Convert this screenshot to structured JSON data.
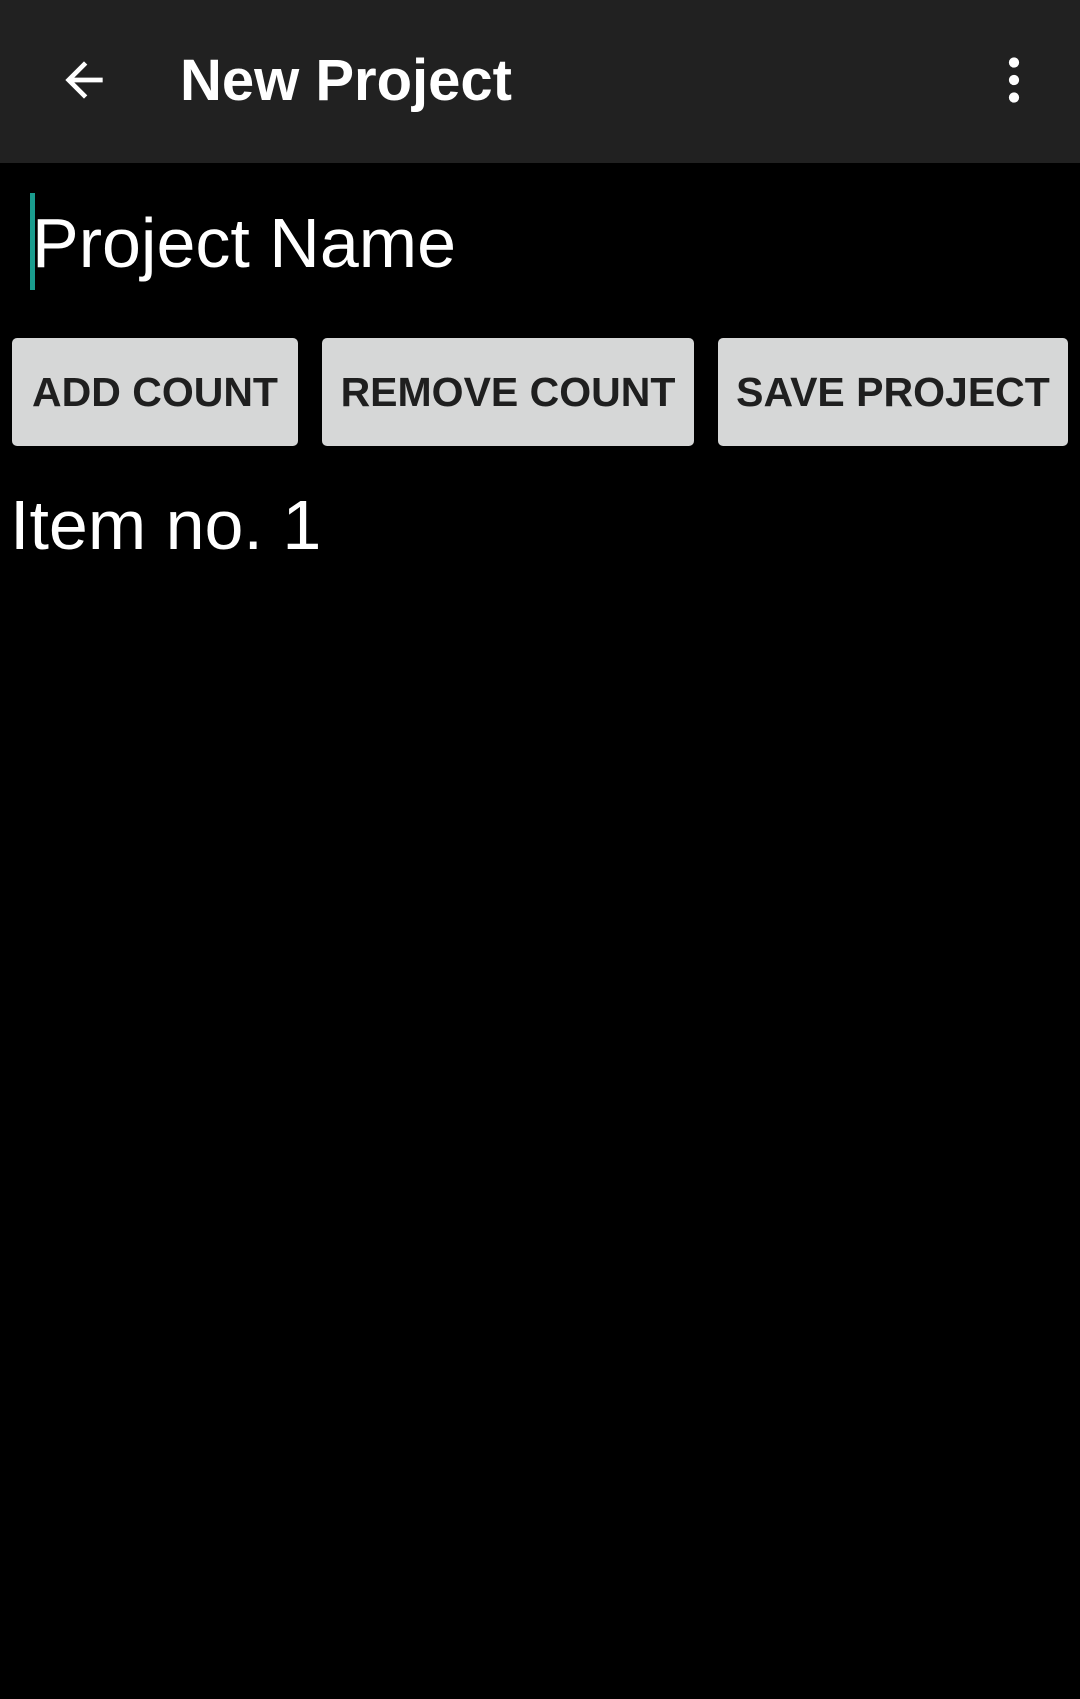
{
  "app_bar": {
    "title": "New Project",
    "back_icon": "arrow-left-icon",
    "overflow_icon": "more-vert-icon",
    "background": "#212121"
  },
  "project_name_field": {
    "placeholder": "Project Name",
    "value": "",
    "caret_color": "#1a9c8e"
  },
  "buttons": {
    "add_count": "ADD COUNT",
    "remove_count": "REMOVE COUNT",
    "save_project": "SAVE PROJECT"
  },
  "items": [
    {
      "label": "Item no. 1"
    }
  ]
}
